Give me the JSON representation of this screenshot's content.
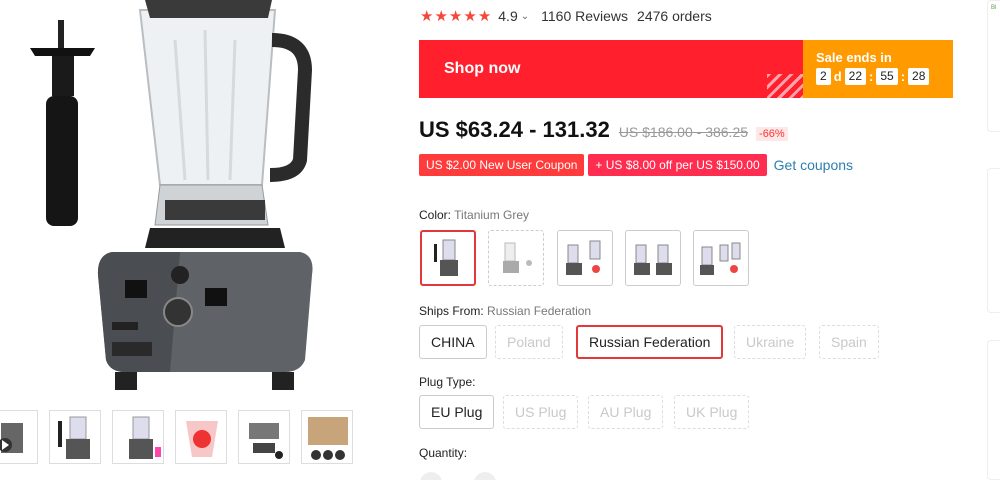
{
  "product": {
    "rating": "4.9",
    "reviews": "1160 Reviews",
    "orders": "2476 orders",
    "stars_count": 5
  },
  "banner": {
    "shop_now": "Shop now",
    "sale_ends": "Sale ends in",
    "countdown": {
      "days": "2",
      "d_label": "d",
      "hours": "22",
      "minutes": "55",
      "seconds": "28"
    }
  },
  "price": {
    "current": "US $63.24 - 131.32",
    "original": "US $186.00 - 386.25",
    "discount": "-66%"
  },
  "coupons": {
    "new_user": "US $2.00 New User Coupon",
    "store": "+ US $8.00 off per US $150.00",
    "get_label": "Get coupons"
  },
  "color": {
    "label": "Color:",
    "selected": "Titanium Grey"
  },
  "ships_from": {
    "label": "Ships From:",
    "selected": "Russian Federation",
    "options": [
      "CHINA",
      "Poland",
      "Russian Federation",
      "Ukraine",
      "Spain"
    ]
  },
  "plug": {
    "label": "Plug Type:",
    "options": [
      "EU Plug",
      "US Plug",
      "AU Plug",
      "UK Plug"
    ]
  },
  "quantity": {
    "label": "Quantity:"
  },
  "side": {
    "text": "Bl"
  },
  "colors": {
    "accent_red": "#ff1f2d",
    "sale_orange": "#ff9a00",
    "star": "#f5473c",
    "link": "#2c7fb0"
  }
}
